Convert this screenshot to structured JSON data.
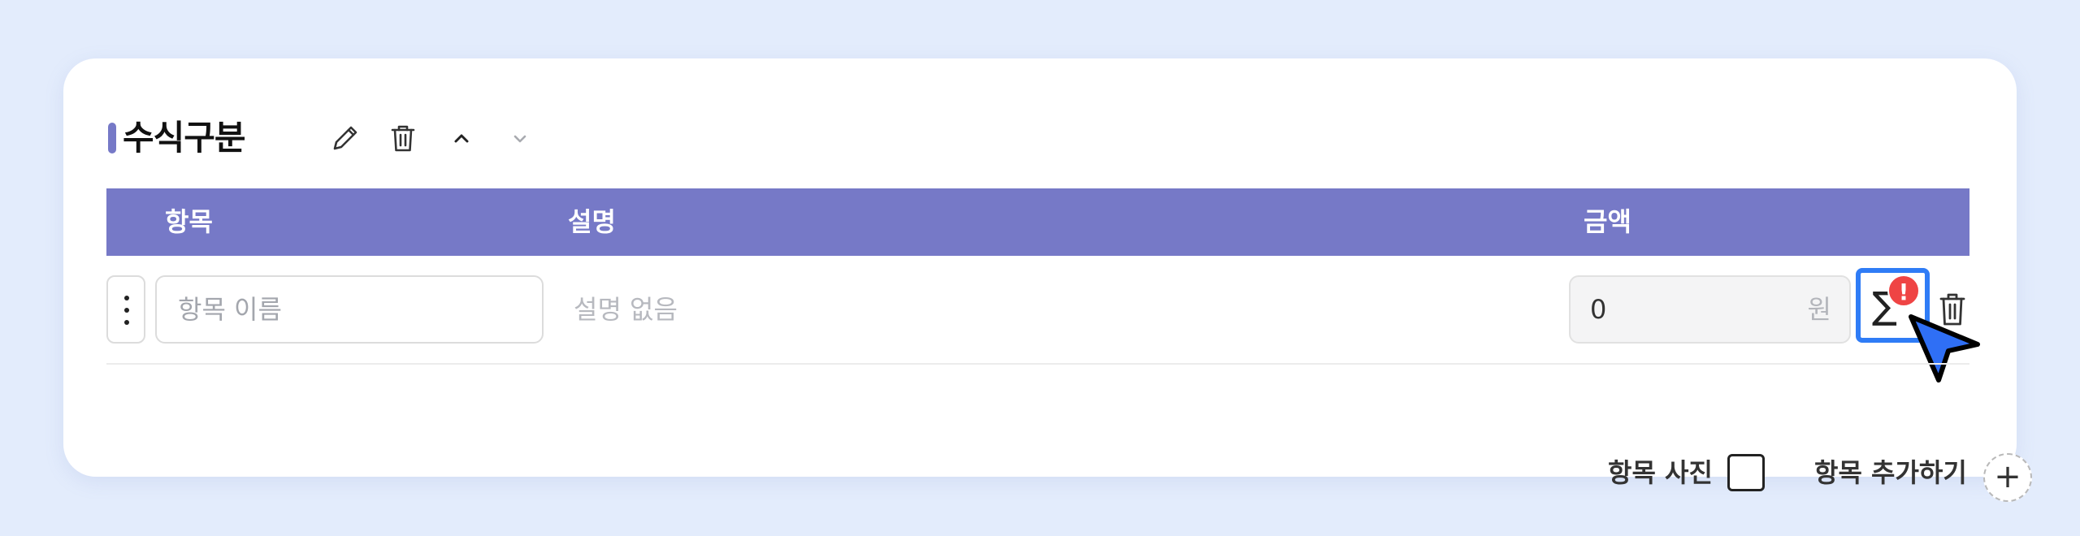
{
  "section": {
    "title": "수식구분",
    "accent_color": "#7679c7",
    "icons": [
      "pencil-icon",
      "trash-icon",
      "chevron-up-icon",
      "chevron-down-icon"
    ]
  },
  "table": {
    "headers": [
      "항목",
      "설명",
      "금액"
    ],
    "header_color": "#7679c7",
    "rows": [
      {
        "name_placeholder": "항목 이름",
        "name_value": "",
        "description": "설명 없음",
        "amount": "0",
        "unit": "원",
        "formula_icon": "∑",
        "alert_badge": "!"
      }
    ]
  },
  "footer": {
    "photo_label": "항목 사진",
    "add_label": "항목 추가하기",
    "add_icon": "+"
  },
  "colors": {
    "highlight": "#2f7cf6",
    "alert": "#ef4444",
    "cursor": "#2f6ff5"
  }
}
